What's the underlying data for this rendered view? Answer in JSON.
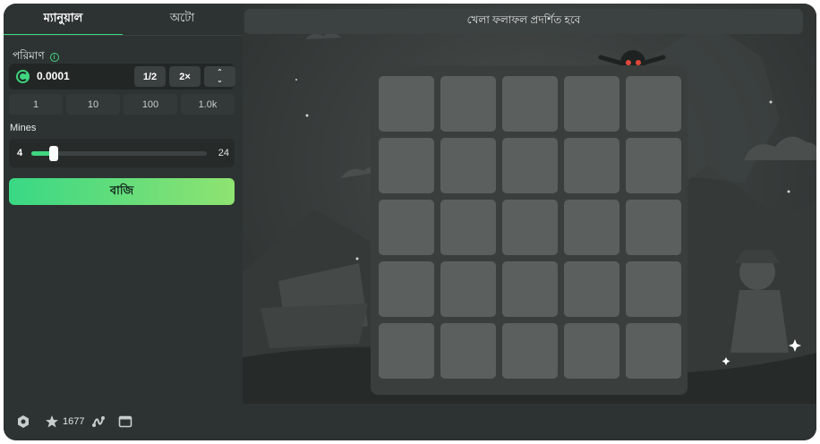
{
  "tabs": {
    "manual": "ম্যানুয়াল",
    "auto": "অটো"
  },
  "amount": {
    "label": "পরিমাণ",
    "info_icon": "info-icon",
    "value": "0.0001",
    "half_label": "1/2",
    "double_label": "2×",
    "up_arrow": "⌃",
    "down_arrow": "⌄"
  },
  "presets": [
    "1",
    "10",
    "100",
    "1.0k"
  ],
  "mines": {
    "label": "Mines",
    "min": "4",
    "max": "24",
    "value_fraction": 0.13
  },
  "bet_button": "বাজি",
  "game": {
    "banner": "খেলা ফলাফল প্রদর্শিত হবে",
    "grid_size": 5
  },
  "footer": {
    "count": "1677"
  },
  "colors": {
    "accent": "#3fd67f",
    "tile": "#5b605e",
    "panel": "#2d3332"
  }
}
